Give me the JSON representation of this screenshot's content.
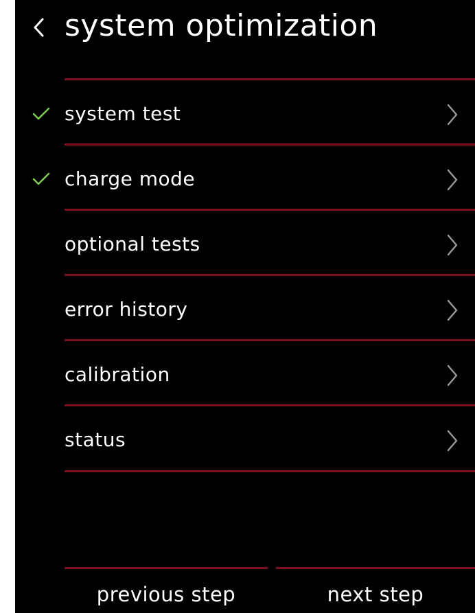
{
  "header": {
    "title": "system optimization",
    "back_icon": "chevron-left-icon"
  },
  "colors": {
    "background": "#000000",
    "text": "#ffffff",
    "divider": "#7a1020",
    "check": "#7ec850",
    "chevron": "#9a9a9a"
  },
  "menu": {
    "items": [
      {
        "label": "system test",
        "completed": true
      },
      {
        "label": "charge mode",
        "completed": true
      },
      {
        "label": "optional tests",
        "completed": false
      },
      {
        "label": "error history",
        "completed": false
      },
      {
        "label": "calibration",
        "completed": false
      },
      {
        "label": "status",
        "completed": false
      }
    ]
  },
  "footer": {
    "previous_label": "previous step",
    "next_label": "next step"
  }
}
